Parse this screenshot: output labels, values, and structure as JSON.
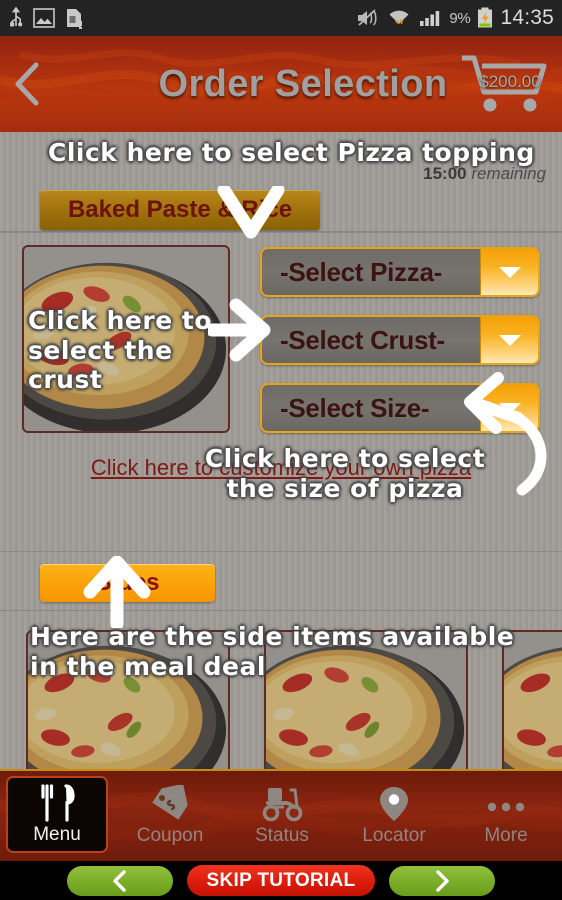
{
  "statusbar": {
    "icons": [
      "usb-icon",
      "image-icon",
      "sdcard-icon",
      "mute-icon",
      "wifi-icon",
      "signal-icon"
    ],
    "battery_percent": "9%",
    "clock": "14:35"
  },
  "header": {
    "back_label": "back-chevron",
    "title": "Order Selection",
    "cart_amount": "$200.00"
  },
  "main": {
    "timer": {
      "value": "15:00",
      "suffix": " remaining"
    },
    "category_tab": "Baked Paste & Rice",
    "dropdowns": [
      {
        "name": "pizza",
        "value": "-Select Pizza-"
      },
      {
        "name": "crust",
        "value": "-Select Crust-"
      },
      {
        "name": "size",
        "value": "-Select Size-"
      }
    ],
    "custom_link": "Click here to customize your own pizza",
    "sides_label": "Sides"
  },
  "tutorial": {
    "tip_topping": "Click here to select Pizza topping",
    "tip_crust": "Click here to select the crust",
    "tip_size": "Click here to select the size of pizza",
    "tip_sides": "Here are the side items available in the meal deal",
    "prev_label": "‹",
    "skip_label": "SKIP TUTORIAL",
    "next_label": "›"
  },
  "bottomnav": {
    "items": [
      {
        "label": "Menu",
        "icon": "cutlery-icon",
        "active": true
      },
      {
        "label": "Coupon",
        "icon": "tag-icon",
        "active": false
      },
      {
        "label": "Status",
        "icon": "scooter-icon",
        "active": false
      },
      {
        "label": "Locator",
        "icon": "pin-icon",
        "active": false
      },
      {
        "label": "More",
        "icon": "ellipsis-icon",
        "active": false
      }
    ]
  },
  "colors": {
    "header_red": "#a72d10",
    "accent_gold": "#e8a417",
    "orange_button": "#fca50b",
    "dark_red_text": "#7d1a14",
    "green_nav": "#79ad27",
    "skip_red": "#dc1c0c"
  }
}
